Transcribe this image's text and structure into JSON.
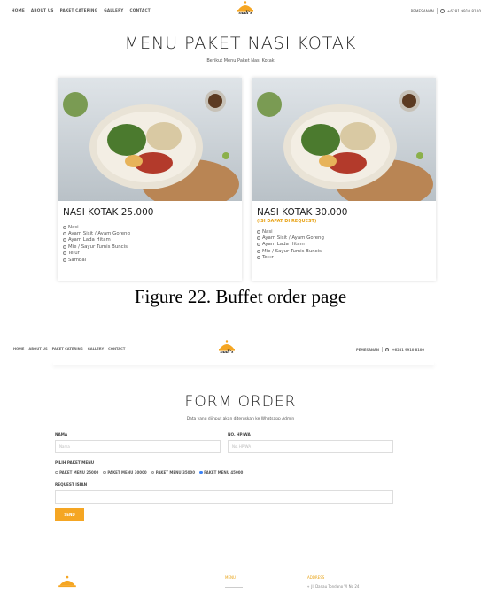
{
  "top": {
    "nav": [
      "HOME",
      "ABOUT US",
      "PAKET CATERING",
      "GALLERY",
      "CONTACT"
    ],
    "brand": "nadi's",
    "order_label": "PEMESANAN",
    "phone": "+6281 9910 8100"
  },
  "menu": {
    "title": "MENU PAKET NASI KOTAK",
    "subtitle": "Berikut Menu Paket Nasi Kotak",
    "cards": [
      {
        "title": "NASI KOTAK 25.000",
        "note": "",
        "items": [
          "Nasi",
          "Ayam Sisit / Ayam Goreng",
          "Ayam Lada Hitam",
          "Mie / Sayur Tumis Buncis",
          "Telur",
          "Sambal"
        ]
      },
      {
        "title": "NASI KOTAK 30.000",
        "note": "(ISI DAPAT DI REQUEST)",
        "items": [
          "Nasi",
          "Ayam Sisit / Ayam Goreng",
          "Ayam Lada Hitam",
          "Mie / Sayur Tumis Buncis",
          "Telur"
        ]
      }
    ]
  },
  "caption1": "Figure 22. Buffet order page",
  "form": {
    "nav": [
      "HOME",
      "ABOUT US",
      "PAKET CATERING",
      "GALLERY",
      "CONTACT"
    ],
    "brand": "nadi's",
    "order_label": "PEMESANAN",
    "phone": "+6281 9910 8100",
    "title": "FORM ORDER",
    "subtitle": "Data yang diinput akan diteruskan ke Whatsapp Admin",
    "name_label": "NAMA",
    "name_placeholder": "Nama",
    "phone_label": "NO. HP/WA",
    "phone_placeholder": "No. HP/WA",
    "package_label": "PILIH PAKET MENU",
    "options": [
      "PAKET MENU 25000",
      "PAKET MENU 30000",
      "PAKET MENU 35000",
      "PAKET MENU 45000"
    ],
    "selected_option": "PAKET MENU 45000",
    "request_label": "REQUEST ISIAN",
    "send_label": "SEND"
  },
  "footer": {
    "menu_heading": "MENU",
    "address_heading": "ADDRESS",
    "address_line": "Jl. Danau Tondano VI No 24"
  },
  "colors": {
    "accent": "#f5a623",
    "radio_selected": "#3b82f6"
  }
}
